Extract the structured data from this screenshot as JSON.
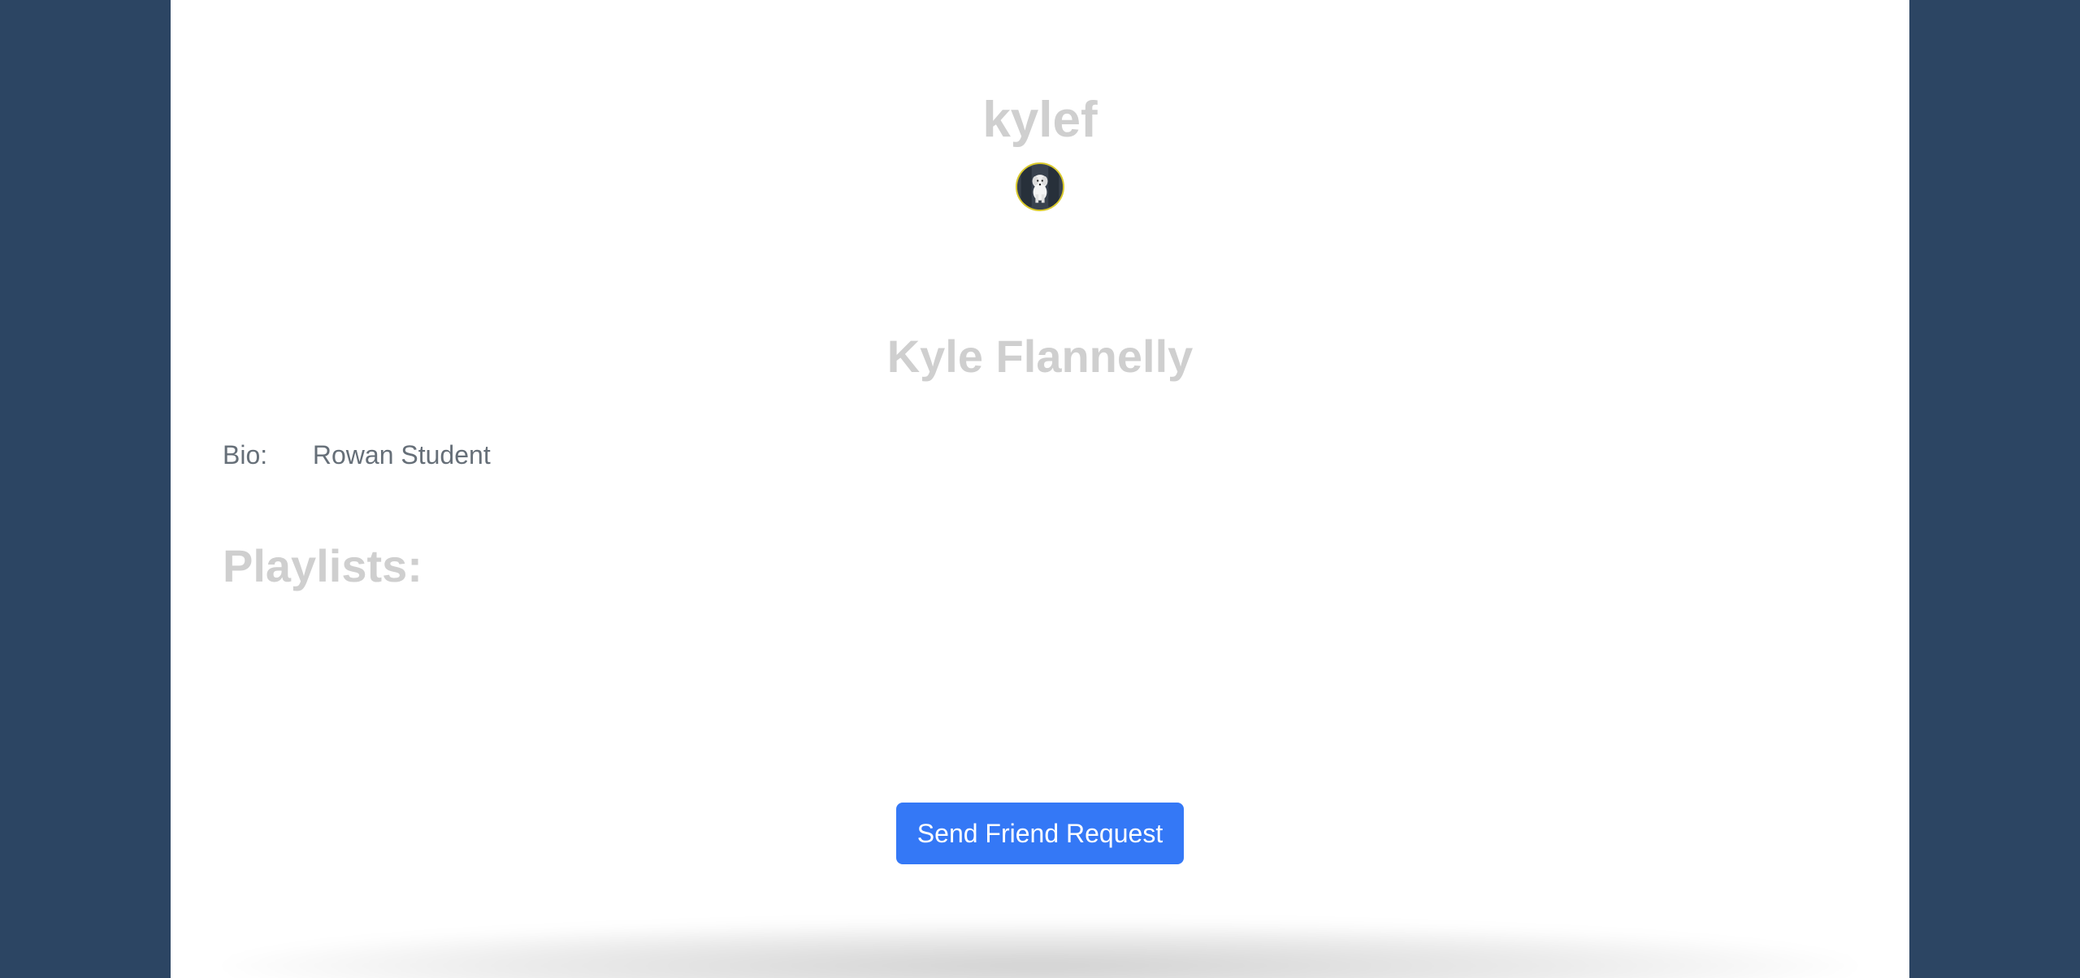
{
  "profile": {
    "username": "kylef",
    "full_name": "Kyle Flannelly",
    "bio_label": "Bio:",
    "bio_value": "Rowan Student"
  },
  "playlists": {
    "title": "Playlists:"
  },
  "actions": {
    "send_friend_request": "Send Friend Request"
  },
  "colors": {
    "background": "#2c4563",
    "card": "#ffffff",
    "heading_text": "#cfcfcf",
    "body_text": "#666f78",
    "button_bg": "#3478f6",
    "button_text": "#ffffff"
  },
  "icons": {
    "avatar": "profile-avatar-dog"
  }
}
